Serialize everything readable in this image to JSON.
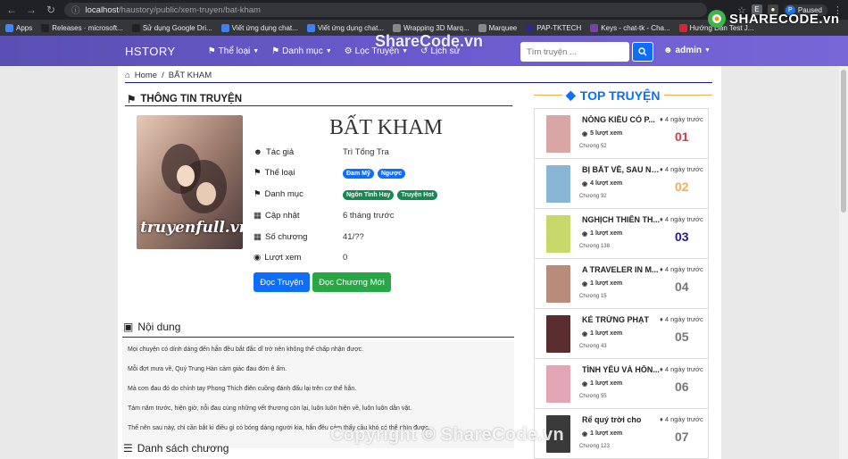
{
  "browser": {
    "url_host": "localhost",
    "url_path": "/haustory/public/xem-truyen/bat-kham",
    "paused_label": "Paused",
    "profile_initial": "P",
    "bookmarks": [
      {
        "label": "Apps",
        "color": "#4285f4"
      },
      {
        "label": "Releases · microsoft...",
        "color": "#222"
      },
      {
        "label": "Sử dụng Google Dri...",
        "color": "#222"
      },
      {
        "label": "Viết ứng dụng chat...",
        "color": "#3b82f6"
      },
      {
        "label": "Viết ứng dụng chat...",
        "color": "#3b82f6"
      },
      {
        "label": "Wrapping 3D Marq...",
        "color": "#888"
      },
      {
        "label": "Marquee",
        "color": "#888"
      },
      {
        "label": "PAP-TKTECH",
        "color": "#2a2a8a"
      },
      {
        "label": "Keys - chat-tk - Cha...",
        "color": "#7b3fb0"
      },
      {
        "label": "Hướng Dẫn Test J...",
        "color": "#d23"
      }
    ]
  },
  "navbar": {
    "brand": "HSTORY",
    "items": [
      "Thể loại",
      "Danh mục",
      "Lọc Truyện",
      "Lịch sử"
    ],
    "search_placeholder": "Tìm truyện ...",
    "user": "admin"
  },
  "breadcrumb": {
    "home": "Home",
    "current": "BẤT KHAM"
  },
  "story": {
    "section_title": "THÔNG TIN TRUYỆN",
    "title": "BẤT KHAM",
    "cover_text": "truyenfull.vn",
    "labels": {
      "author": "Tác giả",
      "genre": "Thể loại",
      "category": "Danh mục",
      "updated": "Cập nhật",
      "chapters": "Số chương",
      "views": "Lượt xem"
    },
    "author": "Trì Tổng Tra",
    "genres": [
      "Đam Mỹ",
      "Ngược"
    ],
    "categories": [
      "Ngôn Tình Hay",
      "Truyện Hot"
    ],
    "updated": "6 tháng trước",
    "chapters": "41/??",
    "views": "0",
    "btn_read": "Đọc Truyện",
    "btn_new": "Đọc Chương Mới"
  },
  "content": {
    "section_title": "Nội dung",
    "paragraphs": [
      "Mọi chuyện có dính dáng đến hắn đều bắt đắc dĩ trở nên không thể chấp nhận được.",
      "Mỗi đợt mưa về, Quý Trung Hàn cảm giác đau đớn ê ẩm.",
      "Mà cơn đau đó do chính tay Phong Thích điên cuồng đánh đấu lại trên cơ thể hắn.",
      "Tám năm trước, hiện giờ, nỗi đau cùng những vết thương còn lại, luôn luôn hiện về, luôn luôn dằn vặt.",
      "Thế nên sau này, chỉ cần bắt kì điều gì có bóng dáng người kia, hắn đều cảm thấy cầu khó có thể nhìn được."
    ]
  },
  "chapter_list": {
    "section_title": "Danh sách chương"
  },
  "top": {
    "title": "TOP TRUYỆN",
    "items": [
      {
        "name": "NỒNG KIỀU CÓ P...",
        "time": "4 ngày trước",
        "views": "5 lượt xem",
        "chapter": "Chương 52",
        "rank": "01",
        "rank_color": "#dc3545",
        "thumb": "#d9a5a5"
      },
      {
        "name": "BỊ BẮT VỀ, SAU NÀ...",
        "time": "4 ngày trước",
        "views": "4 lượt xem",
        "chapter": "Chương 92",
        "rank": "02",
        "rank_color": "#f0ad4e",
        "thumb": "#8ab6d6"
      },
      {
        "name": "NGHỊCH THIÊN TH...",
        "time": "4 ngày trước",
        "views": "1 lượt xem",
        "chapter": "Chương 138",
        "rank": "03",
        "rank_color": "#1a1aa0",
        "thumb": "#c8d86a"
      },
      {
        "name": "A TRAVELER IN M...",
        "time": "4 ngày trước",
        "views": "1 lượt xem",
        "chapter": "Chương 15",
        "rank": "04",
        "rank_color": "#777",
        "thumb": "#b98b7a"
      },
      {
        "name": "KẺ TRỪNG PHẠT",
        "time": "4 ngày trước",
        "views": "1 lượt xem",
        "chapter": "Chương 43",
        "rank": "05",
        "rank_color": "#777",
        "thumb": "#5a2e2e"
      },
      {
        "name": "TÌNH YÊU VÀ HÔN...",
        "time": "4 ngày trước",
        "views": "1 lượt xem",
        "chapter": "Chương 55",
        "rank": "06",
        "rank_color": "#777",
        "thumb": "#e2a6b5"
      },
      {
        "name": "Rể quý trời cho",
        "time": "4 ngày trước",
        "views": "1 lượt xem",
        "chapter": "Chương 123",
        "rank": "07",
        "rank_color": "#777",
        "thumb": "#3a3a3a"
      }
    ]
  },
  "watermarks": {
    "top": "ShareCode.vn",
    "bottom": "Copyright © ShareCode.vn",
    "logo": "SHARECODE.vn"
  }
}
